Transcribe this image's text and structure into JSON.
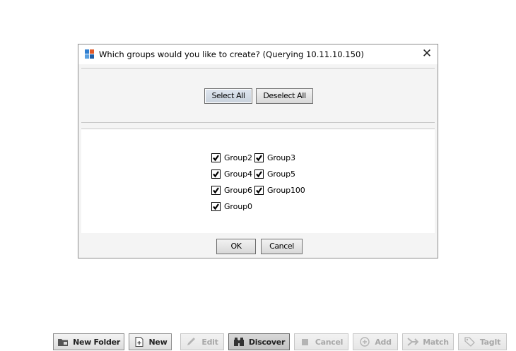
{
  "dialog": {
    "title": "Which groups would you like to create? (Querying 10.11.10.150)",
    "close_glyph": "✕",
    "select_all_label": "Select All",
    "deselect_all_label": "Deselect All",
    "groups": [
      {
        "label": "Group2",
        "checked": true
      },
      {
        "label": "Group3",
        "checked": true
      },
      {
        "label": "Group4",
        "checked": true
      },
      {
        "label": "Group5",
        "checked": true
      },
      {
        "label": "Group6",
        "checked": true
      },
      {
        "label": "Group100",
        "checked": true
      },
      {
        "label": "Group0",
        "checked": true
      }
    ],
    "ok_label": "OK",
    "cancel_label": "Cancel"
  },
  "toolbar": {
    "buttons": [
      {
        "label": "New Folder",
        "icon": "folder-icon",
        "enabled": true
      },
      {
        "label": "New",
        "icon": "new-doc-icon",
        "enabled": true
      },
      {
        "label": "Edit",
        "icon": "pencil-icon",
        "enabled": false
      },
      {
        "label": "Discover",
        "icon": "binoculars-icon",
        "enabled": true,
        "active": true
      },
      {
        "label": "Cancel",
        "icon": "stop-icon",
        "enabled": false
      },
      {
        "label": "Add",
        "icon": "plus-circle-icon",
        "enabled": false
      },
      {
        "label": "Match",
        "icon": "match-icon",
        "enabled": false
      },
      {
        "label": "TagIt",
        "icon": "tag-icon",
        "enabled": false
      }
    ]
  }
}
